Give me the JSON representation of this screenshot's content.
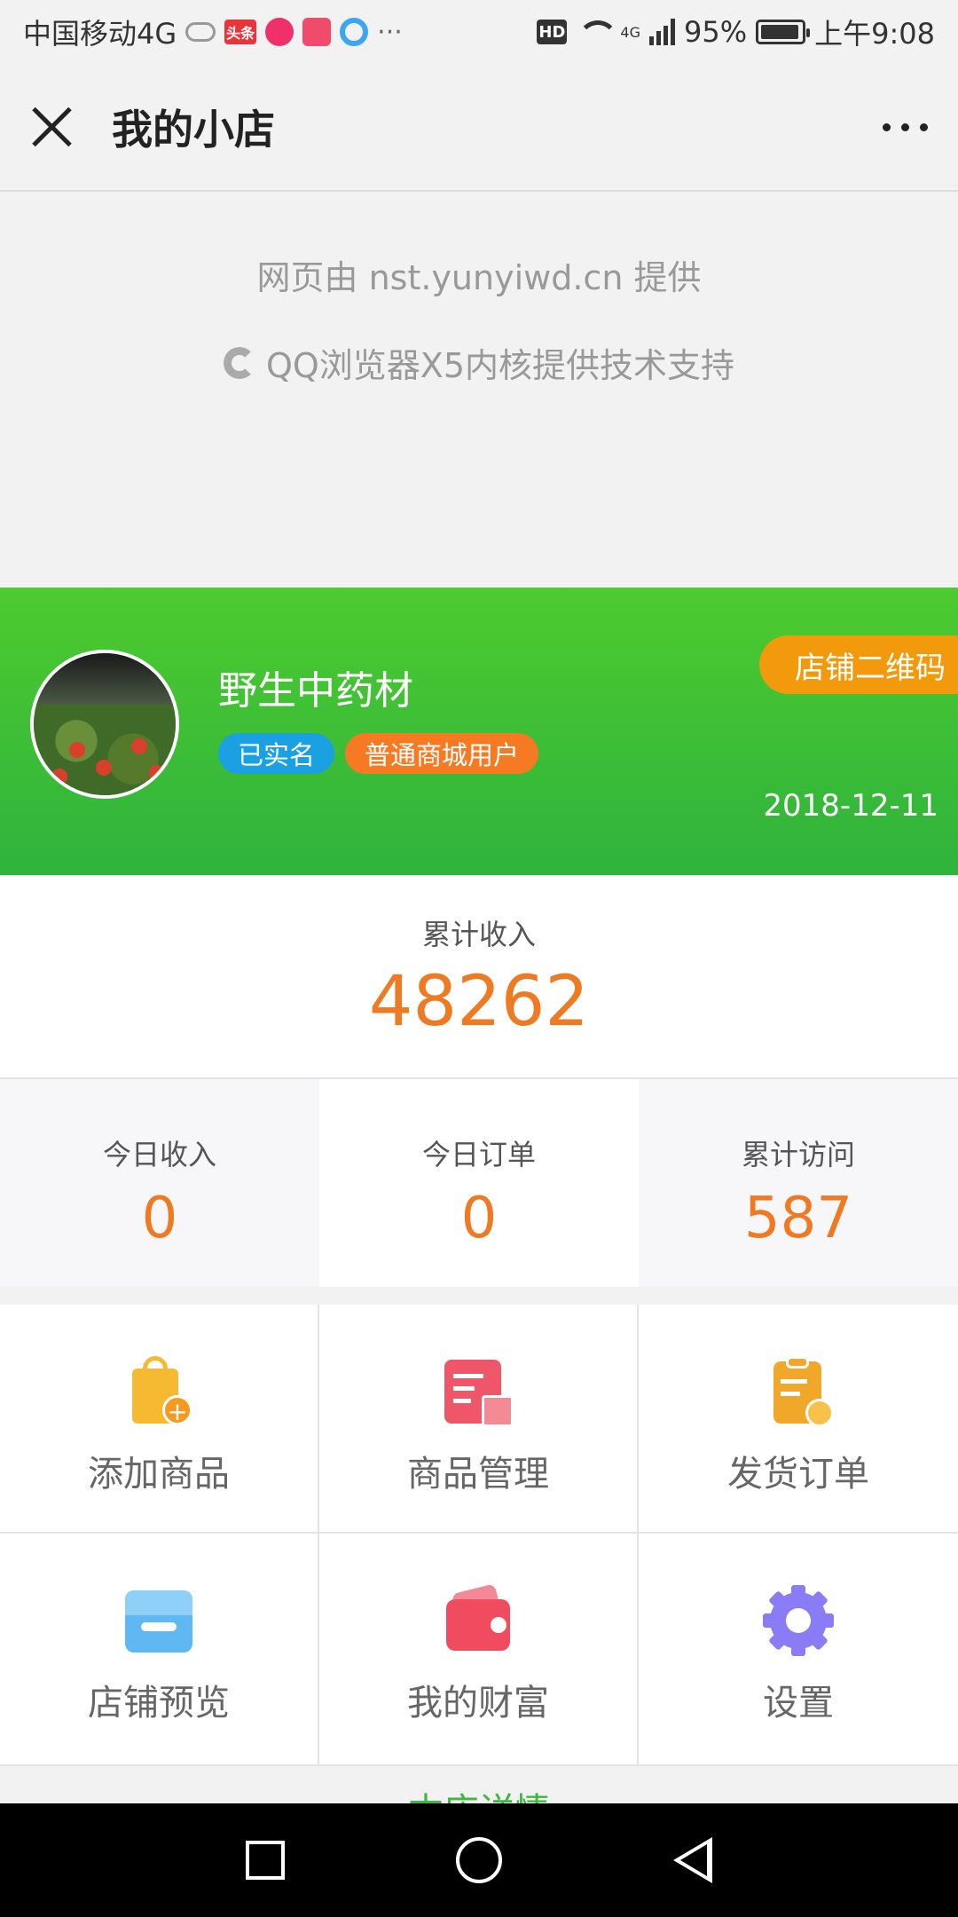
{
  "status_bar": {
    "carrier": "中国移动4G",
    "toutiao_badge": "头条",
    "overflow": "···",
    "hd": "HD",
    "network": "4G",
    "battery_text": "95%",
    "battery_level": 0.95,
    "time": "上午9:08"
  },
  "titlebar": {
    "title": "我的小店"
  },
  "provider": {
    "line1": "网页由 nst.yunyiwd.cn 提供",
    "line2": "QQ浏览器X5内核提供技术支持"
  },
  "shop": {
    "name": "野生中药材",
    "badge_verified": "已实名",
    "badge_user_type": "普通商城用户",
    "qr_button": "店铺二维码",
    "date": "2018-12-11",
    "colors": {
      "header_green": "#3fbf35",
      "badge_blue": "#1ba0e2",
      "badge_orange": "#f57a22",
      "qr_orange": "#f39a0c"
    }
  },
  "total_income": {
    "label": "累计收入",
    "value": "48262"
  },
  "stats": [
    {
      "label": "今日收入",
      "value": "0"
    },
    {
      "label": "今日订单",
      "value": "0"
    },
    {
      "label": "累计访问",
      "value": "587"
    }
  ],
  "menu": [
    {
      "label": "添加商品",
      "icon": "shopping-bag-add-icon"
    },
    {
      "label": "商品管理",
      "icon": "goods-manage-icon"
    },
    {
      "label": "发货订单",
      "icon": "delivery-order-icon"
    },
    {
      "label": "店铺预览",
      "icon": "store-preview-icon"
    },
    {
      "label": "我的财富",
      "icon": "wallet-icon"
    },
    {
      "label": "设置",
      "icon": "gear-icon"
    }
  ],
  "peek_text": "本店详情",
  "accent_color": "#ef7a24"
}
